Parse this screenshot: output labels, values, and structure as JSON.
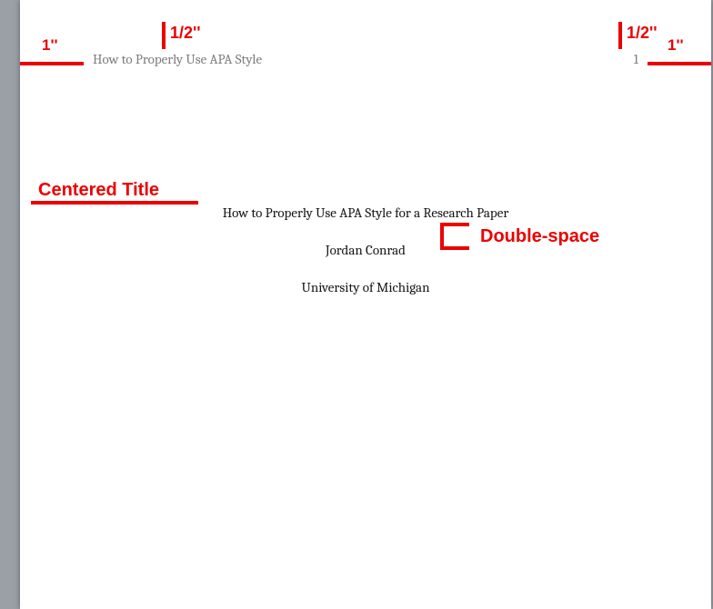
{
  "annotations": {
    "margin_left": "1''",
    "margin_right": "1''",
    "header_half_left": "1/2''",
    "header_half_right": "1/2''",
    "centered_title": "Centered Title",
    "double_space": "Double-space"
  },
  "header": {
    "running_head": "How to Properly Use APA Style",
    "page_number": "1"
  },
  "body": {
    "title": "How to Properly Use APA Style for a Research Paper",
    "author": "Jordan Conrad",
    "affiliation": "University of Michigan"
  }
}
